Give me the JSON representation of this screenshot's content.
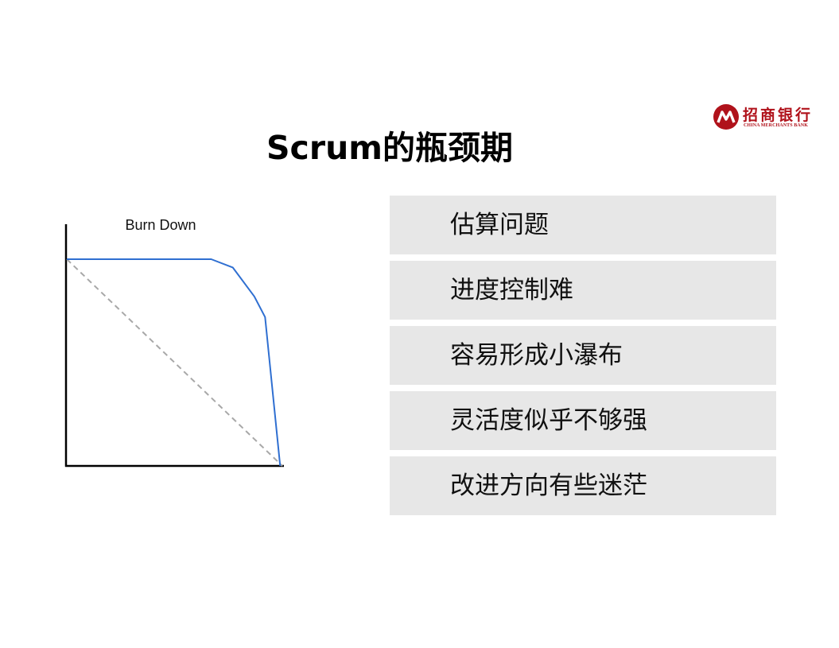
{
  "logo": {
    "name_cn": "招商银行",
    "name_en": "CHINA MERCHANTS BANK",
    "brand_color": "#b0121b"
  },
  "title": "Scrum的瓶颈期",
  "items": [
    {
      "label": "估算问题"
    },
    {
      "label": "进度控制难"
    },
    {
      "label": "容易形成小瀑布"
    },
    {
      "label": "灵活度似乎不够强"
    },
    {
      "label": "改进方向有些迷茫"
    }
  ],
  "chart_data": {
    "type": "line",
    "title": "Burn Down",
    "xlabel": "",
    "ylabel": "",
    "xlim": [
      0,
      10
    ],
    "ylim": [
      0,
      100
    ],
    "grid": false,
    "legend": "none",
    "series": [
      {
        "color": "#2f6fd1",
        "style": "solid",
        "points": [
          [
            0,
            100
          ],
          [
            6.7,
            100
          ],
          [
            7.7,
            96
          ],
          [
            8.7,
            82
          ],
          [
            9.2,
            72
          ],
          [
            9.9,
            0
          ]
        ]
      },
      {
        "color": "#a8a8a8",
        "style": "dashed",
        "points": [
          [
            0,
            100
          ],
          [
            10,
            0
          ]
        ]
      }
    ]
  }
}
